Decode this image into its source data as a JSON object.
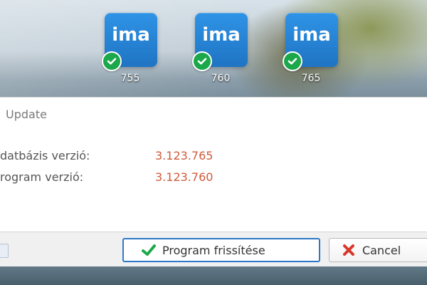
{
  "desktop": {
    "icons": [
      {
        "logo": "ima",
        "label": "755"
      },
      {
        "logo": "ima",
        "label": "760"
      },
      {
        "logo": "ima",
        "label": "765"
      }
    ]
  },
  "dialog": {
    "title": "Update",
    "fields": [
      {
        "label": "datbázis verzió:",
        "value": "3.123.765"
      },
      {
        "label": "rogram verzió:",
        "value": "3.123.760"
      }
    ],
    "buttons": {
      "primary_label": "Program frissítése",
      "cancel_label": "Cancel"
    }
  },
  "colors": {
    "accent": "#2d78c8",
    "version_value": "#d05a3a",
    "icon_tile": "#1f74c3",
    "success": "#1aa84a",
    "cancel_red": "#d9372b"
  },
  "icons": {
    "tile_check": "check-badge-icon",
    "primary_button": "check-icon",
    "cancel_button": "x-icon"
  }
}
